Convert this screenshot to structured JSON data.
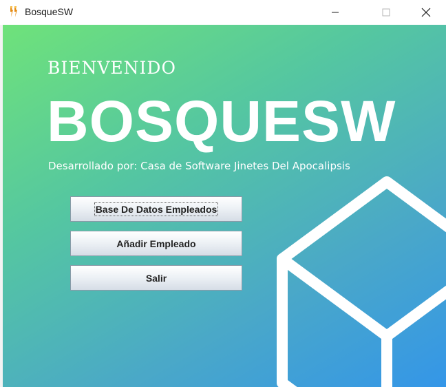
{
  "window": {
    "title": "BosqueSW",
    "icon": "app-logo-icon",
    "controls": [
      "minimize-icon",
      "maximize-icon",
      "close-icon"
    ]
  },
  "main": {
    "welcome": "BIENVENIDO",
    "brand": "BOSQUESW",
    "subtitle": "Desarrollado por: Casa de Software Jinetes Del Apocalipsis"
  },
  "buttons": {
    "database": "Base De Datos Empleados",
    "add_employee": "Añadir Empleado",
    "exit": "Salir"
  },
  "colors": {
    "gradient_start": "#6fe27a",
    "gradient_end": "#3496e8",
    "text": "#ffffff"
  }
}
